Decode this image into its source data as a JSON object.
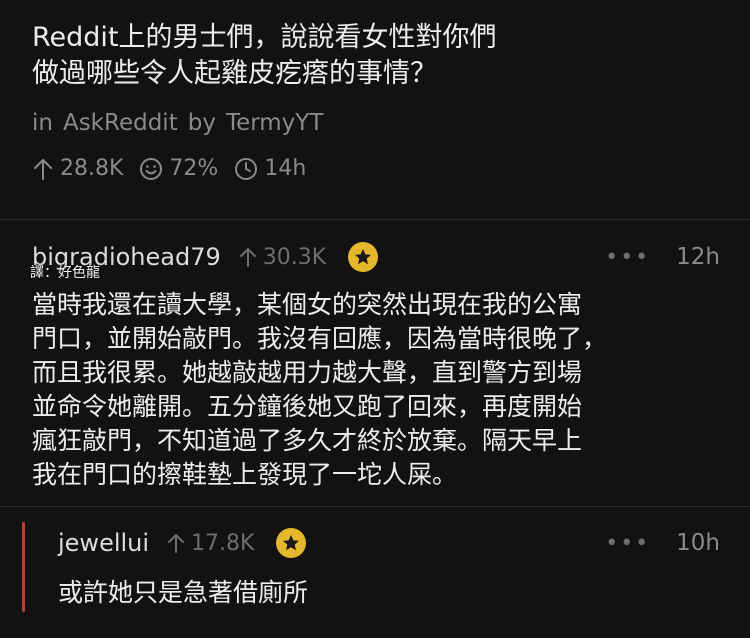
{
  "post": {
    "title_line1": "Reddit上的男士們，說說看女性對你們",
    "title_line2": "做過哪些令人起雞皮疙瘩的事情？",
    "in_label": "in",
    "subreddit": "AskReddit",
    "by_label": "by",
    "author": "TermyYT",
    "upvotes": "28.8K",
    "upvote_ratio": "72%",
    "age": "14h"
  },
  "translator_credit": "譯：好色龍",
  "comments": [
    {
      "username": "bigradiohead79",
      "votes": "30.3K",
      "time": "12h",
      "body_lines": [
        "當時我還在讀大學，某個女的突然出現在我的公寓",
        "門口，並開始敲門。我沒有回應，因為當時很晚了，",
        "而且我很累。她越敲越用力越大聲，直到警方到場",
        "並命令她離開。五分鐘後她又跑了回來，再度開始",
        "瘋狂敲門，不知道過了多久才終於放棄。隔天早上",
        "我在門口的擦鞋墊上發現了一坨人屎。"
      ]
    },
    {
      "username": "jewellui",
      "votes": "17.8K",
      "time": "10h",
      "body_lines": [
        "或許她只是急著借廁所"
      ]
    }
  ],
  "colors": {
    "background": "#121212",
    "award": "#e5b72d",
    "reply_bar": "#c43b2f"
  },
  "icons": {
    "upvote": "arrow-up-icon",
    "ratio": "smiley-icon",
    "age": "clock-icon",
    "award": "star-award-icon",
    "more": "more-dots-icon"
  }
}
